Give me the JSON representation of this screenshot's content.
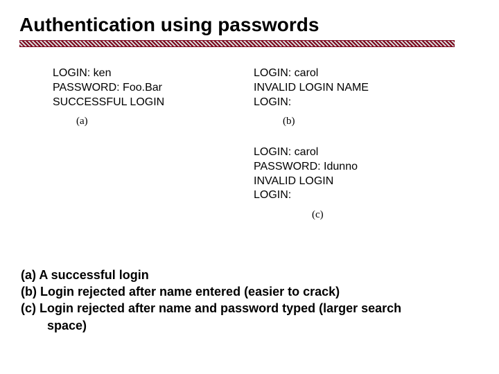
{
  "title": "Authentication using passwords",
  "panels": {
    "a": {
      "label": "(a)",
      "lines": [
        "LOGIN: ken",
        "PASSWORD: Foo.Bar",
        "SUCCESSFUL LOGIN"
      ]
    },
    "b": {
      "label": "(b)",
      "lines": [
        "LOGIN: carol",
        "INVALID LOGIN NAME",
        "LOGIN:"
      ]
    },
    "c": {
      "label": "(c)",
      "lines": [
        "LOGIN: carol",
        "PASSWORD: Idunno",
        "INVALID LOGIN",
        "LOGIN:"
      ]
    }
  },
  "captions": {
    "a": "(a) A successful login",
    "b": "(b) Login rejected after name entered (easier to crack)",
    "c1": "(c) Login rejected after name and password typed (larger search",
    "c2": "space)"
  }
}
